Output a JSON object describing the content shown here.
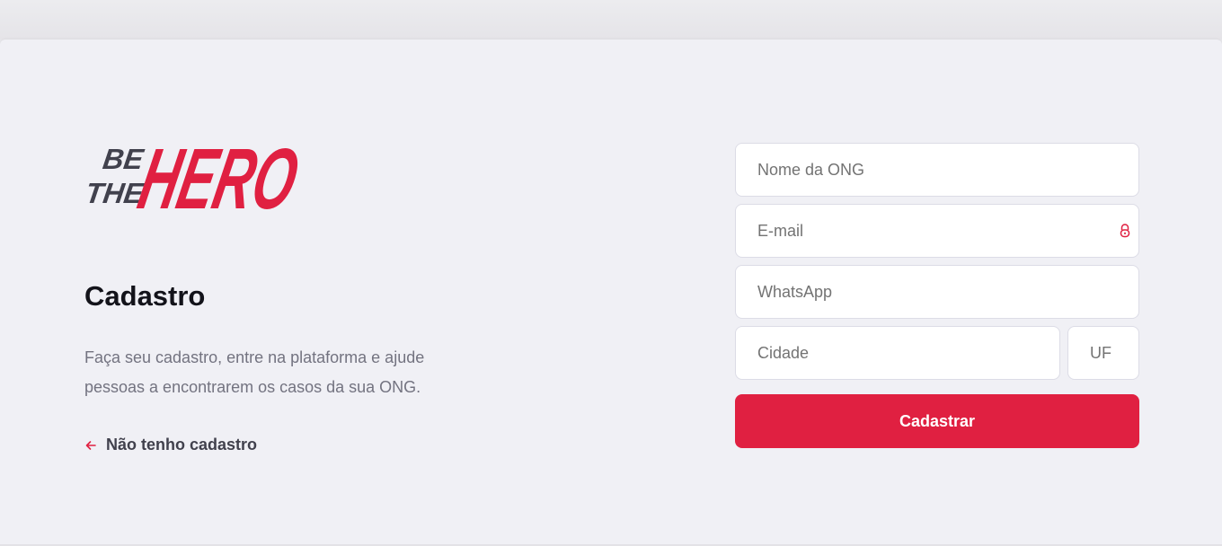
{
  "brand": {
    "logo_text": "BE THE HERO",
    "accent_color": "#E02041",
    "dark_color": "#41414D"
  },
  "intro": {
    "title": "Cadastro",
    "description": "Faça seu cadastro, entre na plataforma e ajude pessoas a encontrarem os casos da sua ONG.",
    "back_link_label": "Não tenho cadastro",
    "back_link_icon": "arrow-left-icon"
  },
  "form": {
    "name_placeholder": "Nome da ONG",
    "email_placeholder": "E-mail",
    "email_icon": "lock-icon",
    "whatsapp_placeholder": "WhatsApp",
    "city_placeholder": "Cidade",
    "uf_placeholder": "UF",
    "submit_label": "Cadastrar"
  }
}
